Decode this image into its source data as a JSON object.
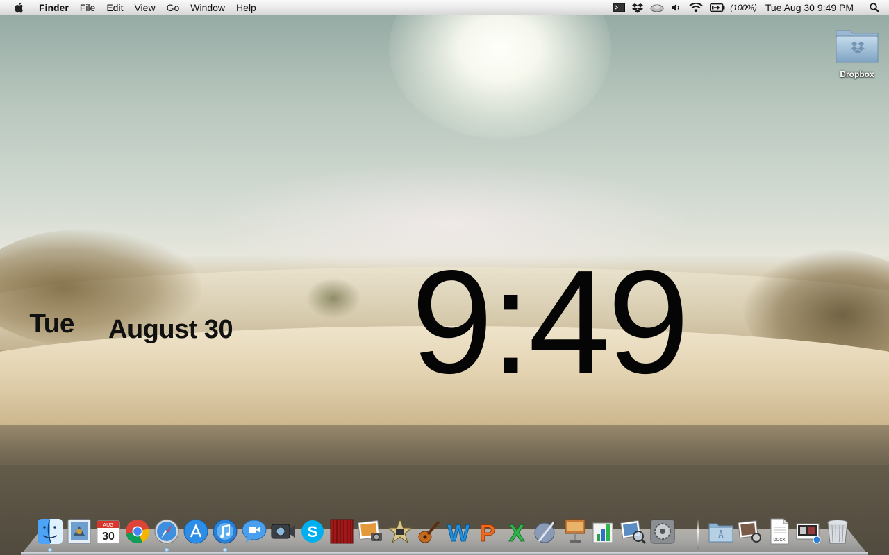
{
  "menubar": {
    "app_name": "Finder",
    "items": [
      "File",
      "Edit",
      "View",
      "Go",
      "Window",
      "Help"
    ],
    "status_icons": [
      "terminal-icon",
      "dropbox-status-icon",
      "cloud-sync-icon",
      "volume-icon",
      "wifi-icon",
      "battery-icon",
      "search-icon"
    ],
    "battery_text": "(100%)",
    "clock_text": "Tue Aug 30  9:49 PM"
  },
  "desktop": {
    "icons": [
      {
        "label": "Dropbox",
        "icon": "dropbox-folder-icon"
      }
    ]
  },
  "clock_widget": {
    "day": "Tue",
    "date": "August 30",
    "time": "9:49"
  },
  "dock": {
    "apps": [
      {
        "name": "Finder",
        "icon": "finder-icon",
        "running": true
      },
      {
        "name": "Mail",
        "icon": "mail-icon",
        "running": false
      },
      {
        "name": "iCal",
        "icon": "calendar-icon",
        "calendar_day": "30",
        "calendar_month": "AUG",
        "running": false
      },
      {
        "name": "Google Chrome",
        "icon": "chrome-icon",
        "running": false
      },
      {
        "name": "Safari",
        "icon": "safari-icon",
        "running": true
      },
      {
        "name": "App Store",
        "icon": "app-store-icon",
        "running": false
      },
      {
        "name": "iTunes",
        "icon": "itunes-icon",
        "running": true
      },
      {
        "name": "iChat",
        "icon": "ichat-icon",
        "running": false
      },
      {
        "name": "FaceTime",
        "icon": "facetime-icon",
        "running": false
      },
      {
        "name": "Skype",
        "icon": "skype-icon",
        "running": false
      },
      {
        "name": "Front Row",
        "icon": "front-row-icon",
        "running": false
      },
      {
        "name": "iPhoto",
        "icon": "iphoto-icon",
        "running": false
      },
      {
        "name": "iMovie",
        "icon": "imovie-icon",
        "running": false
      },
      {
        "name": "GarageBand",
        "icon": "garageband-icon",
        "running": false
      },
      {
        "name": "Word",
        "icon": "word-icon",
        "running": false
      },
      {
        "name": "PowerPoint",
        "icon": "powerpoint-icon",
        "running": false
      },
      {
        "name": "Excel",
        "icon": "excel-icon",
        "running": false
      },
      {
        "name": "Script Editor",
        "icon": "script-editor-icon",
        "running": false
      },
      {
        "name": "Keynote",
        "icon": "keynote-icon",
        "running": false
      },
      {
        "name": "Numbers",
        "icon": "numbers-icon",
        "running": false
      },
      {
        "name": "Preview",
        "icon": "preview-icon",
        "running": false
      },
      {
        "name": "System Preferences",
        "icon": "system-preferences-icon",
        "running": false
      }
    ],
    "stacks": [
      {
        "name": "Applications",
        "icon": "applications-folder-icon"
      },
      {
        "name": "Photos",
        "icon": "photos-stack-icon"
      },
      {
        "name": "Documents",
        "icon": "document-stack-icon",
        "badge_text": "DOCX"
      },
      {
        "name": "Downloads",
        "icon": "downloads-stack-icon"
      },
      {
        "name": "Trash",
        "icon": "trash-icon"
      }
    ]
  },
  "colors": {
    "menubar_top": "#fafafa",
    "menubar_bottom": "#d7d7d7",
    "clock_text": "#050505",
    "running_indicator": "#8fd0ff"
  }
}
